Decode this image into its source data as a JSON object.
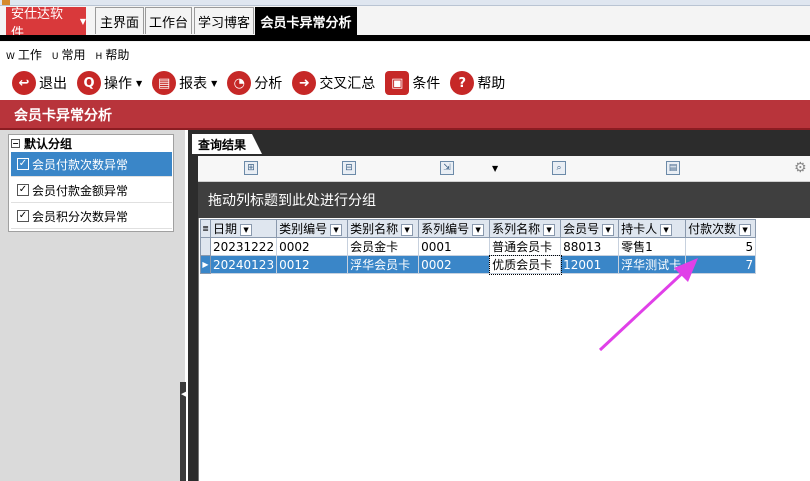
{
  "app": {
    "name": "安仕达软件",
    "accent": "#d9393b"
  },
  "tabs": [
    {
      "label": "主界面",
      "active": false
    },
    {
      "label": "工作台",
      "active": false
    },
    {
      "label": "学习博客",
      "active": false
    },
    {
      "label": "会员卡异常分析",
      "active": true
    }
  ],
  "menu": [
    {
      "key": "W",
      "label": "工作"
    },
    {
      "key": "U",
      "label": "常用"
    },
    {
      "key": "H",
      "label": "帮助"
    }
  ],
  "toolbar": {
    "exit": "退出",
    "operate": "操作",
    "report": "报表",
    "analyze": "分析",
    "cross": "交叉汇总",
    "condition": "条件",
    "help": "帮助"
  },
  "page_title": "会员卡异常分析",
  "left_panel": {
    "group_title": "默认分组",
    "items": [
      {
        "label": "会员付款次数异常",
        "checked": true,
        "selected": true
      },
      {
        "label": "会员付款金额异常",
        "checked": true,
        "selected": false
      },
      {
        "label": "会员积分次数异常",
        "checked": true,
        "selected": false
      }
    ]
  },
  "results": {
    "tab_label": "查询结果",
    "group_hint": "拖动列标题到此处进行分组",
    "columns": [
      "日期",
      "类别编号",
      "类别名称",
      "系列编号",
      "系列名称",
      "会员号",
      "持卡人",
      "付款次数"
    ],
    "rows": [
      [
        "20231222",
        "0002",
        "会员金卡",
        "0001",
        "普通会员卡",
        "88013",
        "零售1",
        "5"
      ],
      [
        "20240123",
        "0012",
        "浮华会员卡",
        "0002",
        "优质会员卡",
        "12001",
        "浮华测试卡",
        "7"
      ]
    ],
    "selected_row": 1
  },
  "annotation_color": "#e040e8"
}
